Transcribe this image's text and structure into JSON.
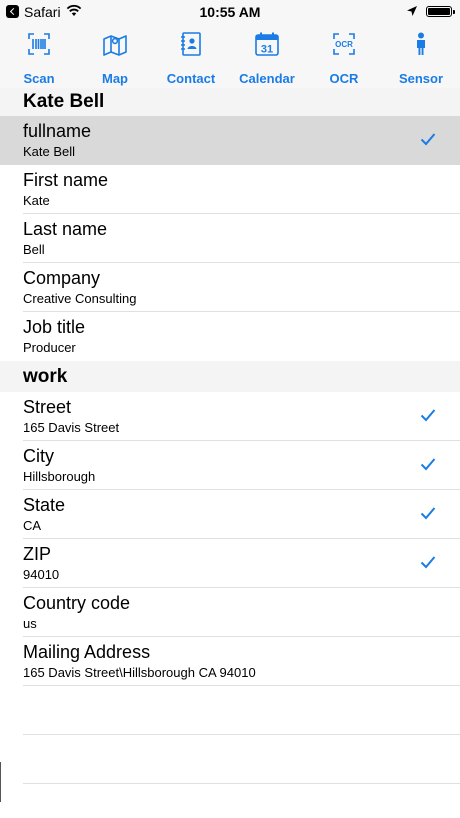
{
  "status_bar": {
    "carrier": "Safari",
    "time": "10:55 AM"
  },
  "toolbar": {
    "items": [
      {
        "label": "Scan",
        "icon": "barcode-icon"
      },
      {
        "label": "Map",
        "icon": "map-icon"
      },
      {
        "label": "Contact",
        "icon": "contact-book-icon"
      },
      {
        "label": "Calendar",
        "icon": "calendar-icon"
      },
      {
        "label": "OCR",
        "icon": "ocr-icon"
      },
      {
        "label": "Sensor",
        "icon": "person-icon"
      }
    ],
    "calendar_day": "31",
    "ocr_text": "OCR",
    "accent_color": "#1a7ce4"
  },
  "contact": {
    "name_header": "Kate Bell",
    "fields": [
      {
        "label": "fullname",
        "value": "Kate Bell",
        "checked": true,
        "selected": true
      },
      {
        "label": "First name",
        "value": "Kate",
        "checked": false
      },
      {
        "label": "Last name",
        "value": "Bell",
        "checked": false
      },
      {
        "label": "Company",
        "value": "Creative Consulting",
        "checked": false
      },
      {
        "label": "Job title",
        "value": "Producer",
        "checked": false
      }
    ]
  },
  "work": {
    "header": "work",
    "fields": [
      {
        "label": "Street",
        "value": "165 Davis Street",
        "checked": true
      },
      {
        "label": "City",
        "value": "Hillsborough",
        "checked": true
      },
      {
        "label": "State",
        "value": "CA",
        "checked": true
      },
      {
        "label": "ZIP",
        "value": "94010",
        "checked": true
      },
      {
        "label": "Country code",
        "value": "us",
        "checked": false
      },
      {
        "label": "Mailing Address",
        "value": "165 Davis Street\\Hillsborough CA 94010",
        "checked": false
      }
    ]
  }
}
